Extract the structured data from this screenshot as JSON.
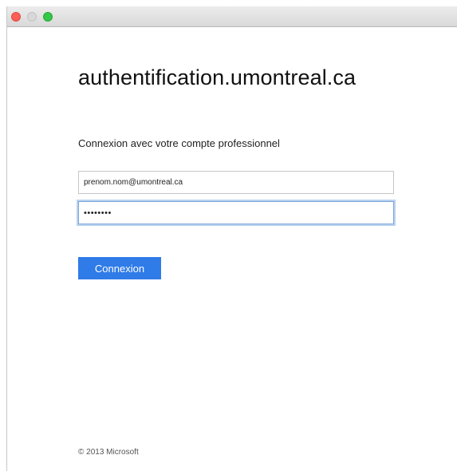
{
  "window": {
    "controls": [
      "close",
      "minimize",
      "zoom"
    ]
  },
  "page": {
    "site_title": "authentification.umontreal.ca",
    "subtitle": "Connexion avec votre compte professionnel",
    "email": {
      "value": "prenom.nom@umontreal.ca"
    },
    "password": {
      "value": "••••••••"
    },
    "signin_label": "Connexion",
    "footer": "© 2013 Microsoft"
  },
  "colors": {
    "accent": "#2f7be8",
    "close": "#fc5f57",
    "zoom": "#34c848",
    "focus_ring": "#b9d2f0"
  }
}
